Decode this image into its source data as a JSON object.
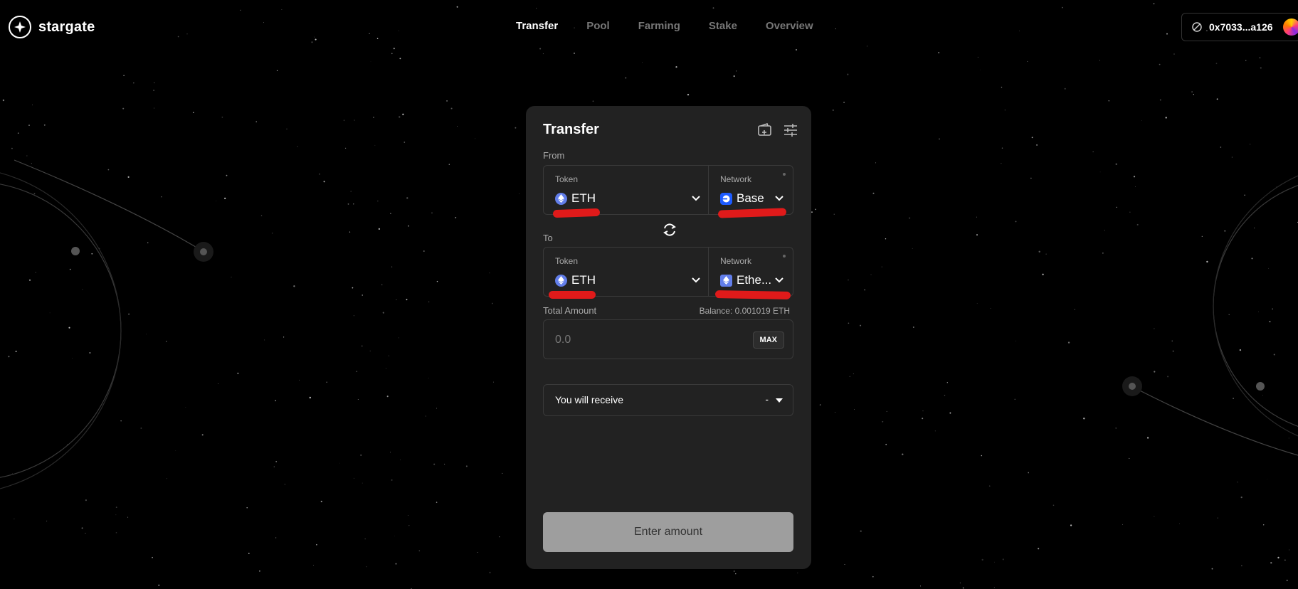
{
  "brand": {
    "name": "stargate"
  },
  "nav": {
    "items": [
      "Transfer",
      "Pool",
      "Farming",
      "Stake",
      "Overview"
    ],
    "active": "Transfer"
  },
  "wallet": {
    "address": "0x7033...a126",
    "status_icon": "no-entry-icon"
  },
  "transfer": {
    "title": "Transfer",
    "from": {
      "label": "From",
      "token_label": "Token",
      "token_value": "ETH",
      "network_label": "Network",
      "network_value": "Base"
    },
    "to": {
      "label": "To",
      "token_label": "Token",
      "token_value": "ETH",
      "network_label": "Network",
      "network_value": "Ethe..."
    },
    "amount": {
      "label": "Total Amount",
      "balance": "Balance: 0.001019 ETH",
      "placeholder": "0.0",
      "max_label": "MAX"
    },
    "receive": {
      "label": "You will receive",
      "value": "-"
    },
    "cta_label": "Enter amount"
  },
  "colors": {
    "background": "#000000",
    "card": "#222222",
    "cta": "#9e9e9e",
    "annotation": "#e01a1a"
  }
}
